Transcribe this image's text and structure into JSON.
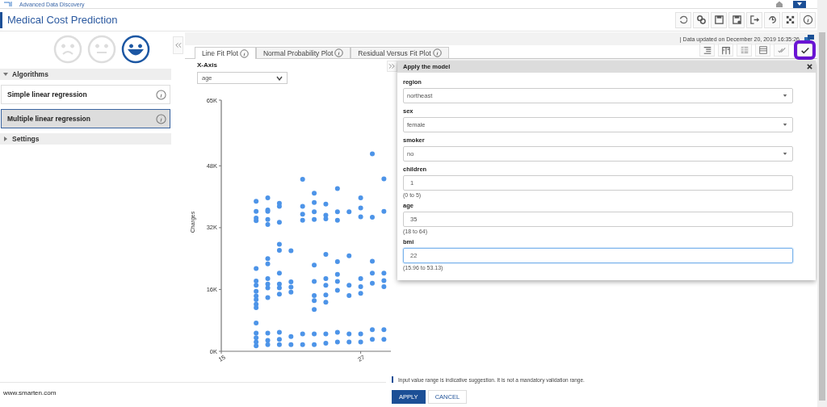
{
  "brand": {
    "text": "Advanced Data Discovery"
  },
  "header": {
    "title": "Medical Cost Prediction"
  },
  "feedback": [
    {
      "kind": "sad",
      "selected": false
    },
    {
      "kind": "neutral",
      "selected": false
    },
    {
      "kind": "happy",
      "selected": true
    }
  ],
  "sidebar": {
    "sections": [
      {
        "title": "Algorithms",
        "expanded": true,
        "items": [
          {
            "label": "Simple linear regression",
            "selected": false
          },
          {
            "label": "Multiple linear regression",
            "selected": true
          }
        ]
      },
      {
        "title": "Settings",
        "expanded": false
      }
    ]
  },
  "status_bar": {
    "text": "|  Data updated on December 20, 2019 16:35:26"
  },
  "tabs": [
    {
      "label": "Line Fit Plot",
      "selected": true
    },
    {
      "label": "Normal Probability Plot",
      "selected": false
    },
    {
      "label": "Residual Versus Fit Plot",
      "selected": false
    }
  ],
  "x_axis": {
    "label": "X-Axis",
    "value": "age"
  },
  "chart_data": {
    "type": "scatter",
    "ylabel": "Charges",
    "xlim": [
      15,
      29.6
    ],
    "ylim": [
      0,
      65000
    ],
    "xticks": [
      15,
      27
    ],
    "yticks": [
      {
        "value": 0,
        "label": "0K"
      },
      {
        "value": 16000,
        "label": "16K"
      },
      {
        "value": 32000,
        "label": "32K"
      },
      {
        "value": 48000,
        "label": "48K"
      },
      {
        "value": 65000,
        "label": "65K"
      }
    ],
    "x": [
      18,
      18,
      18,
      18,
      18,
      18,
      18,
      18,
      18,
      18,
      18,
      18,
      18,
      18,
      18,
      18,
      18,
      19,
      19,
      19,
      19,
      19,
      19,
      19,
      19,
      19,
      19,
      19,
      19,
      19,
      19,
      20,
      20,
      20,
      20,
      20,
      20,
      20,
      20,
      20,
      20,
      20,
      20,
      21,
      21,
      21,
      21,
      21,
      21,
      22,
      22,
      22,
      22,
      22,
      22,
      23,
      23,
      23,
      23,
      23,
      23,
      23,
      23,
      23,
      23,
      23,
      24,
      24,
      24,
      24,
      24,
      24,
      24,
      24,
      24,
      24,
      25,
      25,
      25,
      25,
      25,
      25,
      25,
      25,
      25,
      26,
      26,
      26,
      26,
      26,
      26,
      27,
      27,
      27,
      27,
      27,
      27,
      27,
      27,
      28,
      28,
      28,
      28,
      28,
      28,
      28,
      29,
      29,
      29,
      29,
      29,
      29,
      29
    ],
    "series": [
      {
        "color": "#4d94e8",
        "values": [
          38800,
          36200,
          34500,
          33800,
          21400,
          18200,
          17100,
          15500,
          14300,
          13400,
          12200,
          11300,
          7300,
          4700,
          3500,
          2400,
          1400,
          39700,
          36600,
          36200,
          34100,
          32800,
          24000,
          22600,
          18800,
          17400,
          16400,
          13900,
          4700,
          2800,
          1700,
          38300,
          37500,
          33400,
          27700,
          26100,
          20200,
          17400,
          16400,
          14800,
          4900,
          3100,
          1700,
          26000,
          18000,
          16600,
          15300,
          3800,
          1700,
          44500,
          37500,
          35500,
          33900,
          4500,
          1700,
          40900,
          38500,
          36100,
          34100,
          22300,
          18100,
          14400,
          13100,
          10800,
          4500,
          1700,
          38100,
          35200,
          34300,
          25100,
          18800,
          17100,
          14600,
          12700,
          4500,
          2100,
          42100,
          36100,
          33900,
          23200,
          19900,
          18100,
          15800,
          4900,
          2400,
          36100,
          24700,
          17100,
          14400,
          4500,
          2400,
          39700,
          37100,
          34800,
          18800,
          16700,
          15000,
          4500,
          2400,
          51100,
          34700,
          23300,
          20200,
          17600,
          5600,
          3100,
          44600,
          36200,
          20200,
          18300,
          16700,
          5600,
          3100
        ]
      }
    ]
  },
  "modal": {
    "title": "Apply the model",
    "fields": [
      {
        "kind": "select",
        "label": "region",
        "value": "northeast",
        "focused": false
      },
      {
        "kind": "select",
        "label": "sex",
        "value": "female",
        "focused": false
      },
      {
        "kind": "select",
        "label": "smoker",
        "value": "no",
        "focused": false
      },
      {
        "kind": "input",
        "label": "children",
        "value": "1",
        "hint": "(0 to 5)",
        "focused": false
      },
      {
        "kind": "input",
        "label": "age",
        "value": "35",
        "hint": "(18 to 64)",
        "focused": false
      },
      {
        "kind": "input",
        "label": "bmi",
        "value": "22",
        "hint": "(15.96 to 53.13)",
        "focused": true
      }
    ]
  },
  "note": {
    "text": "Input value range is indicative suggestion. It is not a mandatory validation range."
  },
  "buttons": [
    {
      "label": "APPLY",
      "kind": "primary"
    },
    {
      "label": "CANCEL",
      "kind": "secondary"
    }
  ],
  "footer": {
    "text": "www.smarten.com"
  }
}
